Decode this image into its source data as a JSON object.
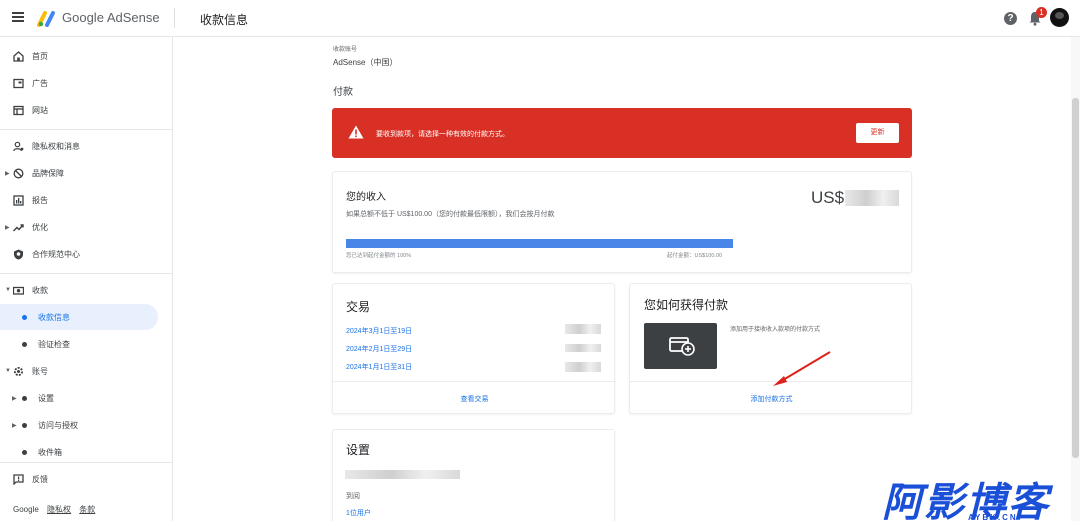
{
  "topbar": {
    "brand": "Google AdSense",
    "page_title": "收款信息",
    "help_icon": "?",
    "notification_count": "1"
  },
  "sidebar": {
    "items": [
      {
        "label": "首页",
        "icon": "home-icon"
      },
      {
        "label": "广告",
        "icon": "ads-icon"
      },
      {
        "label": "网站",
        "icon": "sites-icon"
      },
      {
        "label": "隐私权和消息",
        "icon": "privacy-icon"
      },
      {
        "label": "品牌保障",
        "icon": "block-icon"
      },
      {
        "label": "报告",
        "icon": "report-icon"
      },
      {
        "label": "优化",
        "icon": "trend-icon"
      },
      {
        "label": "合作规范中心",
        "icon": "policy-icon"
      },
      {
        "label": "收款",
        "icon": "payments-icon"
      },
      {
        "label": "收款信息",
        "icon": "dot"
      },
      {
        "label": "验证检查",
        "icon": "dot"
      },
      {
        "label": "账号",
        "icon": "gear-icon"
      },
      {
        "label": "设置",
        "icon": "dot"
      },
      {
        "label": "访问与授权",
        "icon": "dot"
      },
      {
        "label": "收件箱",
        "icon": "dot"
      },
      {
        "label": "反馈",
        "icon": "feedback-icon"
      }
    ],
    "footer": {
      "google": "Google",
      "privacy": "隐私权",
      "terms": "条款"
    }
  },
  "main": {
    "account_label": "收款账号",
    "account_value": "AdSense（中国）",
    "section_label": "付款",
    "alert": {
      "text": "要收到款项，请选择一种有效的付款方式。",
      "button": "更新",
      "color": "#d93025"
    },
    "income": {
      "title": "您的收入",
      "amount": "US$",
      "description": "如果总额不低于 US$100.00（您的付款最低限额），我们会按月付款",
      "progress_fraction": 1.0,
      "progress_left": "您已达到起付金额的 100%",
      "progress_right": "起付金额：US$100.00",
      "bar_color": "#4a86e8"
    },
    "transactions": {
      "title": "交易",
      "rows": [
        "2024年3月1日至19日",
        "2024年2月1日至29日",
        "2024年1月1日至31日"
      ],
      "link": "查看交易"
    },
    "how_paid": {
      "title": "您如何获得付款",
      "description": "添加用于接收收入款项的付款方式",
      "link": "添加付款方式"
    },
    "settings": {
      "title": "设置",
      "label": "到阅",
      "link": "1位用户"
    }
  },
  "watermark": {
    "main": "阿影博客",
    "sub": "AYBK.CN"
  }
}
